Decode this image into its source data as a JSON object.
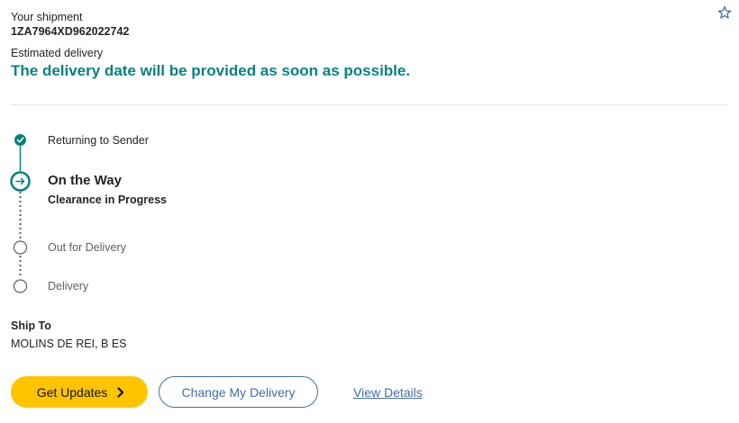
{
  "shipment": {
    "label": "Your shipment",
    "tracking_number": "1ZA7964XD962022742",
    "estimated_label": "Estimated delivery",
    "estimated_message": "The delivery date will be provided as soon as possible."
  },
  "progress": {
    "steps": [
      {
        "label": "Returning to Sender",
        "state": "complete"
      },
      {
        "label": "On the Way",
        "sublabel": "Clearance in Progress",
        "state": "current"
      },
      {
        "label": "Out for Delivery",
        "state": "pending"
      },
      {
        "label": "Delivery",
        "state": "pending"
      }
    ]
  },
  "ship_to": {
    "label": "Ship To",
    "value": "MOLINS DE REI, B ES"
  },
  "actions": {
    "get_updates": "Get Updates",
    "change_delivery": "Change My Delivery",
    "view_details": "View Details"
  },
  "colors": {
    "accent_teal": "#0a8080",
    "button_yellow": "#ffc400",
    "link_blue": "#426da9"
  },
  "icons": {
    "favorite": "star-outline-icon",
    "complete": "check-circle-icon",
    "current": "arrow-right-circle-icon",
    "pending": "empty-circle-icon",
    "button": "chevron-right-icon"
  }
}
